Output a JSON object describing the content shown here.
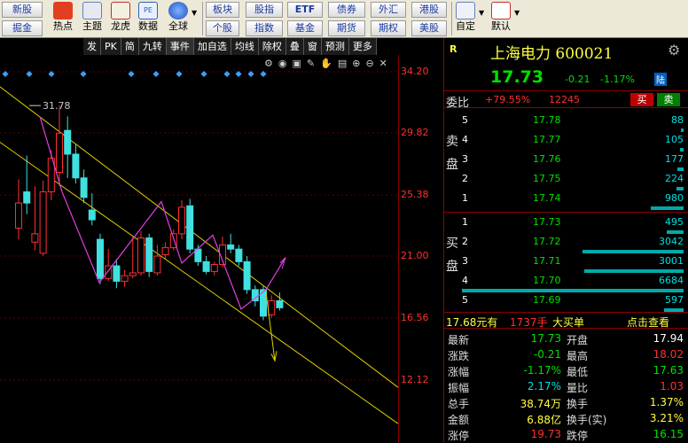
{
  "toolbar": {
    "row1": [
      "新股",
      "热点",
      "主题",
      "龙虎",
      "数据",
      "全球"
    ],
    "row1_small": [
      "新股"
    ],
    "row2_small": [
      "掘金"
    ],
    "big_labels": [
      "热点",
      "主题",
      "龙虎",
      "数据",
      "全球"
    ],
    "board_buttons_top": [
      "板块",
      "股指",
      "ETF",
      "债券",
      "外汇",
      "港股"
    ],
    "board_buttons_bottom": [
      "个股",
      "指数",
      "基金",
      "期货",
      "期权",
      "美股"
    ],
    "custom_label": "自定",
    "default_label": "默认"
  },
  "chart_toolbar": {
    "tabs": [
      "发",
      "PK",
      "简",
      "九转",
      "事件",
      "加自选",
      "均线",
      "除权",
      "叠",
      "窗",
      "预测",
      "更多"
    ]
  },
  "chart_data": {
    "type": "candlestick",
    "y_axis_labels": [
      "34.20",
      "29.82",
      "25.38",
      "21.00",
      "16.56",
      "12.12"
    ],
    "y_axis_values": [
      34.2,
      29.82,
      25.38,
      21.0,
      16.56,
      12.12
    ],
    "high_annotation": "31.78",
    "candles": [
      {
        "o": 23.0,
        "c": 24.8,
        "h": 26.5,
        "l": 22.2
      },
      {
        "o": 25.6,
        "c": 24.8,
        "h": 28.2,
        "l": 24.0
      },
      {
        "o": 22.0,
        "c": 22.6,
        "h": 26.0,
        "l": 21.4
      },
      {
        "o": 21.2,
        "c": 25.6,
        "h": 26.4,
        "l": 21.0
      },
      {
        "o": 25.6,
        "c": 28.0,
        "h": 28.6,
        "l": 25.0
      },
      {
        "o": 27.0,
        "c": 29.8,
        "h": 31.78,
        "l": 26.0
      },
      {
        "o": 30.0,
        "c": 28.3,
        "h": 31.0,
        "l": 26.6
      },
      {
        "o": 28.3,
        "c": 26.6,
        "h": 29.0,
        "l": 26.2
      },
      {
        "o": 26.6,
        "c": 25.2,
        "h": 27.2,
        "l": 24.8
      },
      {
        "o": 24.3,
        "c": 23.6,
        "h": 25.5,
        "l": 23.2
      },
      {
        "o": 22.2,
        "c": 19.4,
        "h": 22.6,
        "l": 19.0
      },
      {
        "o": 19.4,
        "c": 20.3,
        "h": 21.5,
        "l": 19.2
      },
      {
        "o": 20.3,
        "c": 19.2,
        "h": 20.8,
        "l": 18.7
      },
      {
        "o": 19.2,
        "c": 19.6,
        "h": 20.0,
        "l": 18.8
      },
      {
        "o": 19.6,
        "c": 19.8,
        "h": 22.4,
        "l": 19.4
      },
      {
        "o": 19.8,
        "c": 22.3,
        "h": 22.8,
        "l": 19.6
      },
      {
        "o": 22.3,
        "c": 19.9,
        "h": 22.6,
        "l": 19.5
      },
      {
        "o": 19.8,
        "c": 21.0,
        "h": 21.8,
        "l": 19.6
      },
      {
        "o": 21.1,
        "c": 21.6,
        "h": 22.0,
        "l": 20.8
      },
      {
        "o": 21.6,
        "c": 22.6,
        "h": 22.9,
        "l": 21.4
      },
      {
        "o": 22.6,
        "c": 24.5,
        "h": 25.0,
        "l": 22.2
      },
      {
        "o": 24.6,
        "c": 21.5,
        "h": 25.1,
        "l": 21.2
      },
      {
        "o": 21.5,
        "c": 20.6,
        "h": 21.8,
        "l": 20.3
      },
      {
        "o": 20.6,
        "c": 19.9,
        "h": 21.0,
        "l": 19.7
      },
      {
        "o": 19.9,
        "c": 20.4,
        "h": 20.6,
        "l": 19.6
      },
      {
        "o": 20.4,
        "c": 21.8,
        "h": 22.4,
        "l": 20.2
      },
      {
        "o": 21.8,
        "c": 21.5,
        "h": 22.6,
        "l": 21.2
      },
      {
        "o": 21.5,
        "c": 20.6,
        "h": 21.8,
        "l": 20.3
      },
      {
        "o": 20.6,
        "c": 18.6,
        "h": 21.0,
        "l": 18.3
      },
      {
        "o": 18.6,
        "c": 17.8,
        "h": 18.9,
        "l": 17.4
      },
      {
        "o": 18.6,
        "c": 16.7,
        "h": 18.9,
        "l": 16.4
      },
      {
        "o": 16.8,
        "c": 17.8,
        "h": 18.2,
        "l": 16.6
      },
      {
        "o": 17.8,
        "c": 17.3,
        "h": 18.4,
        "l": 17.1
      }
    ],
    "grid": true
  },
  "quote": {
    "badge": "R",
    "name": "上海电力",
    "code": "600021",
    "last_price": "17.73",
    "change": "-0.21",
    "change_pct": "-1.17%",
    "market_tag": "陆",
    "weibi_label": "委比",
    "weibi_pct": "+79.55%",
    "weibi_diff": "12245",
    "buy_btn": "买",
    "sell_btn": "卖",
    "sell_side_label": [
      "卖",
      "盘"
    ],
    "buy_side_label": [
      "买",
      "盘"
    ],
    "asks": [
      {
        "level": "5",
        "price": "17.78",
        "volume": "88"
      },
      {
        "level": "4",
        "price": "17.77",
        "volume": "105"
      },
      {
        "level": "3",
        "price": "17.76",
        "volume": "177"
      },
      {
        "level": "2",
        "price": "17.75",
        "volume": "224"
      },
      {
        "level": "1",
        "price": "17.74",
        "volume": "980"
      }
    ],
    "bids": [
      {
        "level": "1",
        "price": "17.73",
        "volume": "495"
      },
      {
        "level": "2",
        "price": "17.72",
        "volume": "3042"
      },
      {
        "level": "3",
        "price": "17.71",
        "volume": "3001"
      },
      {
        "level": "4",
        "price": "17.70",
        "volume": "6684"
      },
      {
        "level": "5",
        "price": "17.69",
        "volume": "597"
      }
    ],
    "ticker": {
      "amount": "17.68元有",
      "hands": "1737手",
      "label": "大买单",
      "link": "点击查看"
    },
    "stats": [
      {
        "l": "最新",
        "lv": "17.73",
        "lc": "#00e000",
        "r": "开盘",
        "rv": "17.94",
        "rc": "#ffffff"
      },
      {
        "l": "涨跌",
        "lv": "-0.21",
        "lc": "#00e000",
        "r": "最高",
        "rv": "18.02",
        "rc": "#ff3030"
      },
      {
        "l": "涨幅",
        "lv": "-1.17%",
        "lc": "#00e000",
        "r": "最低",
        "rv": "17.63",
        "rc": "#00e000"
      },
      {
        "l": "振幅",
        "lv": "2.17%",
        "lc": "#00e0e0",
        "r": "量比",
        "rv": "1.03",
        "rc": "#ff3030"
      },
      {
        "l": "总手",
        "lv": "38.74万",
        "lc": "#ffff40",
        "r": "换手",
        "rv": "1.37%",
        "rc": "#ffff40"
      },
      {
        "l": "金额",
        "lv": "6.88亿",
        "lc": "#ffff40",
        "r": "换手(实)",
        "rv": "3.21%",
        "rc": "#ffff40"
      },
      {
        "l": "涨停",
        "lv": "19.73",
        "lc": "#ff3030",
        "r": "跌停",
        "rv": "16.15",
        "rc": "#00e000"
      }
    ]
  }
}
